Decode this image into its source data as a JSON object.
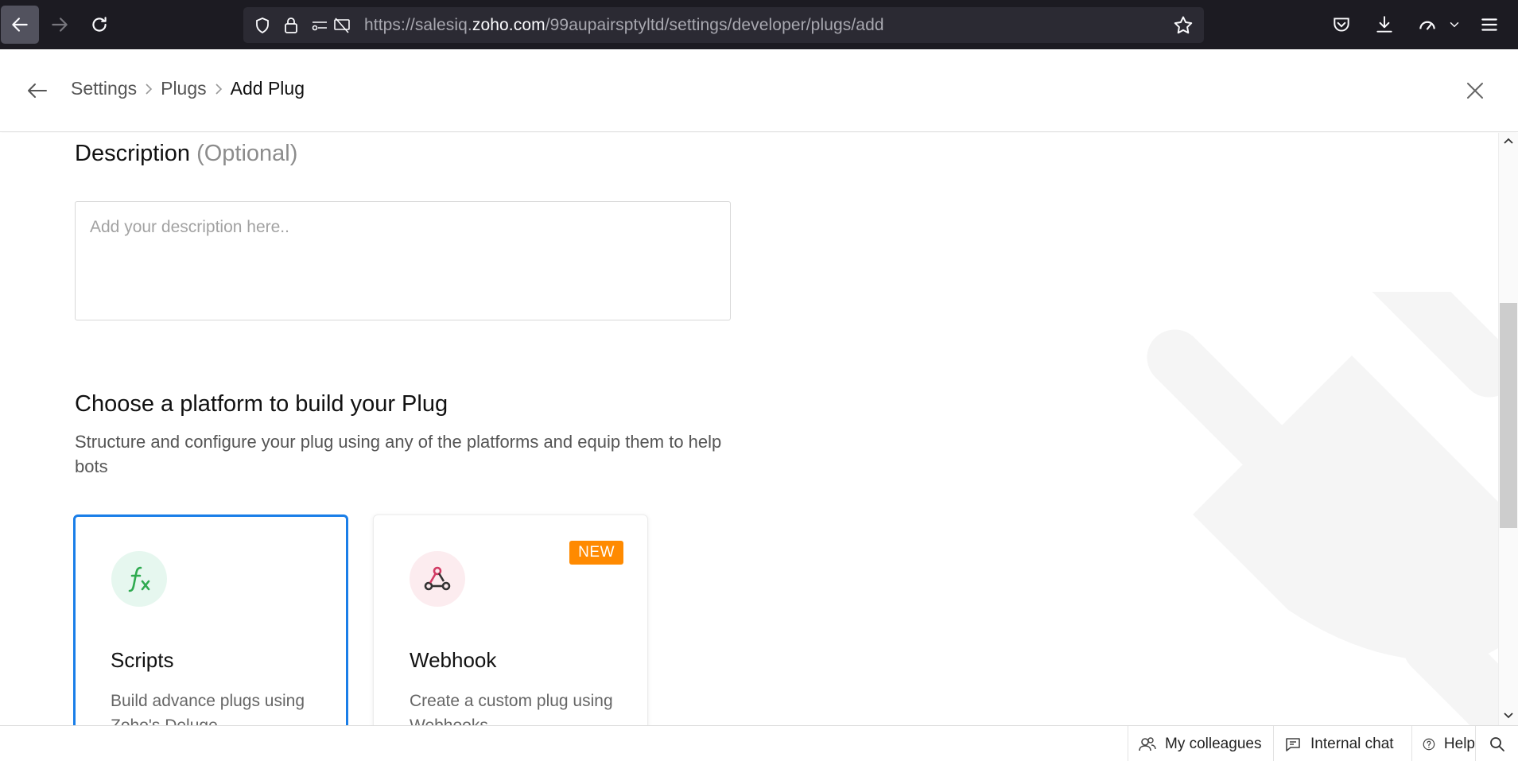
{
  "browser": {
    "url_prefix": "https://salesiq.",
    "url_domain": "zoho.com",
    "url_path": "/99aupairsptyltd/settings/developer/plugs/add"
  },
  "header": {
    "breadcrumbs": [
      "Settings",
      "Plugs",
      "Add Plug"
    ]
  },
  "description": {
    "title": "Description",
    "optional_label": "(Optional)",
    "placeholder": "Add your description here.."
  },
  "platform": {
    "title": "Choose a platform to build your Plug",
    "subtitle": "Structure and configure your plug using any of the platforms and equip them to help bots",
    "cards": [
      {
        "title": "Scripts",
        "description": "Build advance plugs using Zoho's Deluge",
        "selected": true,
        "icon": "function-fx-icon",
        "accent": "#1a7ee8"
      },
      {
        "title": "Webhook",
        "description": "Create a custom plug using Webhooks",
        "badge": "NEW",
        "icon": "webhook-icon",
        "badge_color": "#ff8a00"
      }
    ]
  },
  "bottom_bar": {
    "colleagues": "My colleagues",
    "internal_chat": "Internal chat",
    "help": "Help"
  }
}
